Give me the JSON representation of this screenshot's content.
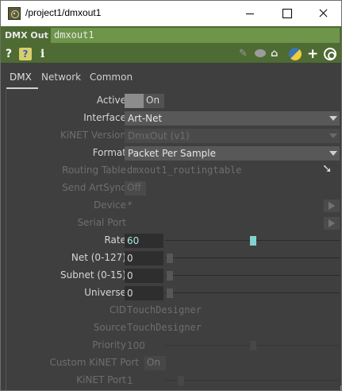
{
  "window": {
    "title": "/project1/dmxout1"
  },
  "header": {
    "op_type": "DMX Out",
    "op_name": "dmxout1"
  },
  "icons": {
    "help": "?",
    "python_help": "?",
    "info": "i",
    "edit": "✎",
    "plus": "+",
    "tag": "⌂"
  },
  "tabs": [
    {
      "label": "DMX"
    },
    {
      "label": "Network"
    },
    {
      "label": "Common"
    }
  ],
  "params": {
    "active": {
      "label": "Active",
      "value": "On"
    },
    "interface": {
      "label": "Interface",
      "value": "Art-Net"
    },
    "kinet_version": {
      "label": "KiNET Version",
      "value": "DmxOut (v1)"
    },
    "format": {
      "label": "Format",
      "value": "Packet Per Sample"
    },
    "routing_table": {
      "label": "Routing Table",
      "value": "dmxout1_routingtable"
    },
    "send_artsync": {
      "label": "Send ArtSync",
      "value": "Off"
    },
    "device": {
      "label": "Device",
      "value": "*"
    },
    "serial_port": {
      "label": "Serial Port",
      "value": ""
    },
    "rate": {
      "label": "Rate",
      "value": "60"
    },
    "net": {
      "label": "Net (0-127)",
      "value": "0"
    },
    "subnet": {
      "label": "Subnet (0-15)",
      "value": "0"
    },
    "universe": {
      "label": "Universe",
      "value": "0"
    },
    "cid": {
      "label": "CID",
      "value": "TouchDesigner"
    },
    "source": {
      "label": "Source",
      "value": "TouchDesigner"
    },
    "priority": {
      "label": "Priority",
      "value": "100"
    },
    "custom_kinet_port": {
      "label": "Custom KiNET Port",
      "value": "On"
    },
    "kinet_port": {
      "label": "KiNET Port",
      "value": "1"
    }
  },
  "colors": {
    "header_green": "#4e6b33",
    "name_field_green": "#6e9549",
    "panel_bg": "#3f3f3f",
    "active_value_cyan": "#a6e8e0"
  }
}
